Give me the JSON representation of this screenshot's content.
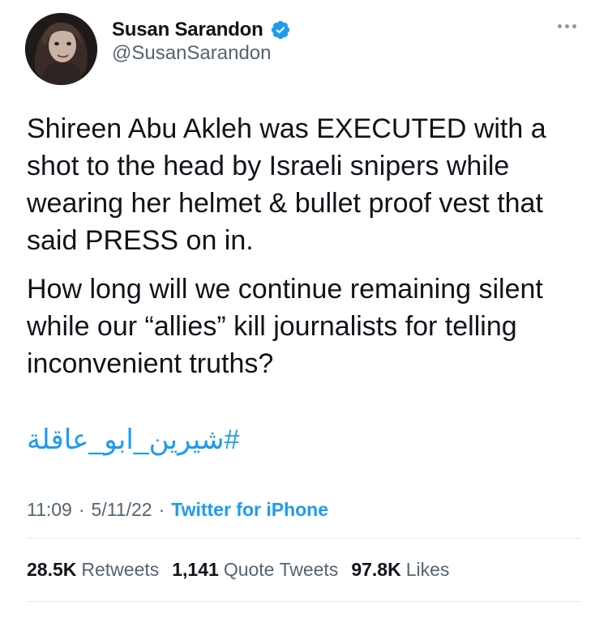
{
  "account": {
    "display_name": "Susan Sarandon",
    "handle": "@SusanSarandon",
    "verified": true,
    "verified_color": "#1d9bf0"
  },
  "tweet": {
    "paragraph_1": "Shireen Abu Akleh was EXECUTED with a shot to the head by Israeli snipers while wearing her helmet & bullet proof vest that said PRESS on in.",
    "paragraph_2": "How long will we continue remaining silent while our “allies” kill journalists for telling inconvenient truths?",
    "hashtag": "#شيرين_ابو_عاقلة",
    "time": "11:09",
    "date": "5/11/22",
    "source": "Twitter for iPhone",
    "separator": "·"
  },
  "stats": {
    "retweets_count": "28.5K",
    "retweets_label": "Retweets",
    "quotes_count": "1,141",
    "quotes_label": "Quote Tweets",
    "likes_count": "97.8K",
    "likes_label": "Likes"
  },
  "icons": {
    "more": "more-horizontal-icon",
    "verified": "verified-badge-icon"
  },
  "colors": {
    "link": "#1d9bf0",
    "secondary_text": "#536471",
    "primary_text": "#0f1419"
  }
}
